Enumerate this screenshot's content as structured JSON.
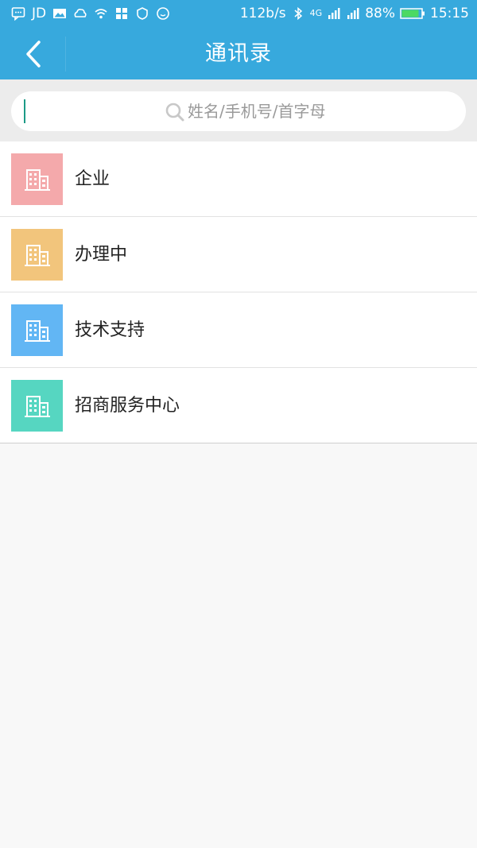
{
  "status_bar": {
    "left_icons": [
      "message-icon",
      "jd-icon",
      "image-icon",
      "cloud-icon",
      "wifi-icon",
      "app-grid-icon",
      "shield-icon",
      "smile-icon"
    ],
    "jd_label": "JD",
    "speed": "112b/s",
    "network": "4G",
    "battery": "88%",
    "time": "15:15",
    "battery_color": "#4cd964"
  },
  "header": {
    "title": "通讯录",
    "background": "#37a9dd"
  },
  "search": {
    "placeholder": "姓名/手机号/首字母",
    "value": ""
  },
  "contacts": [
    {
      "label": "企业",
      "icon": "building-icon",
      "color": "#f4a9ab"
    },
    {
      "label": "办理中",
      "icon": "building-icon",
      "color": "#f2c57c"
    },
    {
      "label": "技术支持",
      "icon": "building-icon",
      "color": "#62b6f4"
    },
    {
      "label": "招商服务中心",
      "icon": "building-icon",
      "color": "#56d6c1"
    }
  ]
}
